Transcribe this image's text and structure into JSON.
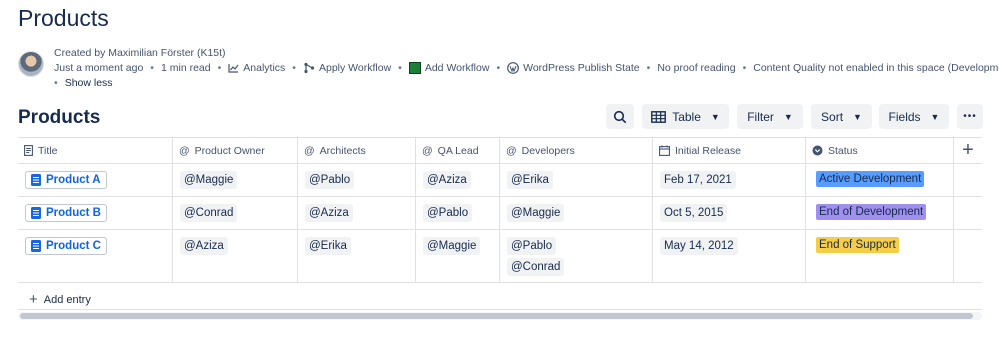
{
  "page": {
    "title": "Products"
  },
  "meta": {
    "created_by": "Created by Maximilian Förster (K15t)",
    "time": "Just a moment ago",
    "read_time": "1 min read",
    "analytics": "Analytics",
    "apply_workflow": "Apply Workflow",
    "add_workflow": "Add Workflow",
    "wordpress": "WordPress Publish State",
    "proof": "No proof reading",
    "quality": "Content Quality not enabled in this space (Development)",
    "show_less": "Show less"
  },
  "database": {
    "title": "Products",
    "toolbar": {
      "view": "Table",
      "filter": "Filter",
      "sort": "Sort",
      "fields": "Fields",
      "more": "•••"
    },
    "columns": [
      {
        "label": "Title",
        "icon": "page-icon"
      },
      {
        "label": "Product Owner",
        "icon": "mention-icon"
      },
      {
        "label": "Architects",
        "icon": "mention-icon"
      },
      {
        "label": "QA Lead",
        "icon": "mention-icon"
      },
      {
        "label": "Developers",
        "icon": "mention-icon"
      },
      {
        "label": "Initial Release",
        "icon": "calendar-icon"
      },
      {
        "label": "Status",
        "icon": "status-icon"
      }
    ],
    "rows": [
      {
        "title": "Product A",
        "owner": "@Maggie",
        "architects": "@Pablo",
        "qa": "@Aziza",
        "developers": [
          "@Erika"
        ],
        "release": "Feb 17, 2021",
        "status": "Active Development",
        "status_color": "#579dff"
      },
      {
        "title": "Product B",
        "owner": "@Conrad",
        "architects": "@Aziza",
        "qa": "@Pablo",
        "developers": [
          "@Maggie"
        ],
        "release": "Oct 5, 2015",
        "status": "End of Development",
        "status_color": "#9f8fef"
      },
      {
        "title": "Product C",
        "owner": "@Aziza",
        "architects": "@Erika",
        "qa": "@Maggie",
        "developers": [
          "@Pablo",
          "@Conrad"
        ],
        "release": "May 14, 2012",
        "status": "End of Support",
        "status_color": "#f5cd47"
      }
    ],
    "add_entry": "Add entry"
  }
}
